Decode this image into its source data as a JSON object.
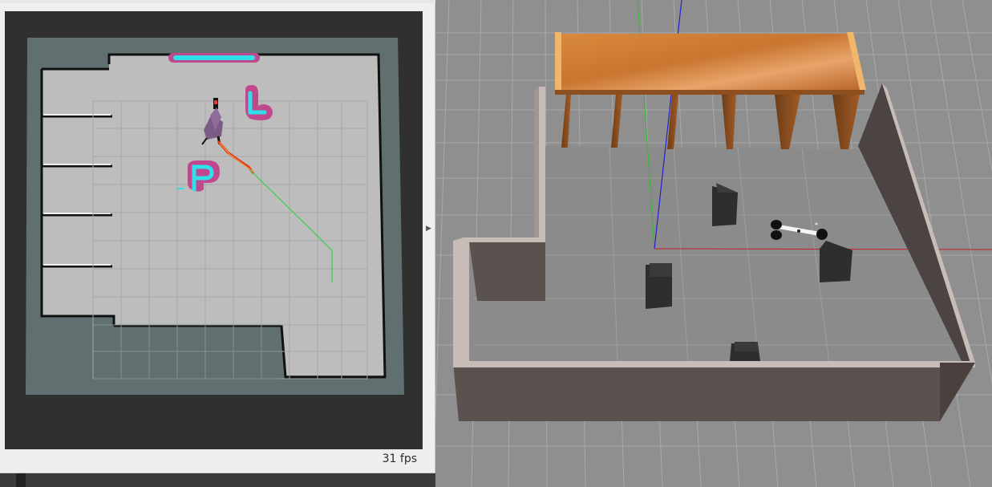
{
  "rviz": {
    "fps": "31 fps",
    "icons": {
      "collapse": "right-arrow-icon"
    }
  },
  "colors": {
    "rviz_background": "#303030",
    "map_unknown": "#607070",
    "map_free": "#bdbdbd",
    "map_wall": "#111111",
    "costmap_inflation": "#c0488e",
    "costmap_lethal": "#2fe0e8",
    "global_plan": "#32d24a",
    "local_plan": "#e03a1e",
    "gazebo_floor": "#8e8e8e",
    "gazebo_wall": "#5b514e",
    "gazebo_wall_top": "#c7bcb8",
    "table_wood": "#c9782f",
    "x_axis": "#c22020",
    "y_axis": "#2ec02e",
    "z_axis": "#2222d0"
  }
}
